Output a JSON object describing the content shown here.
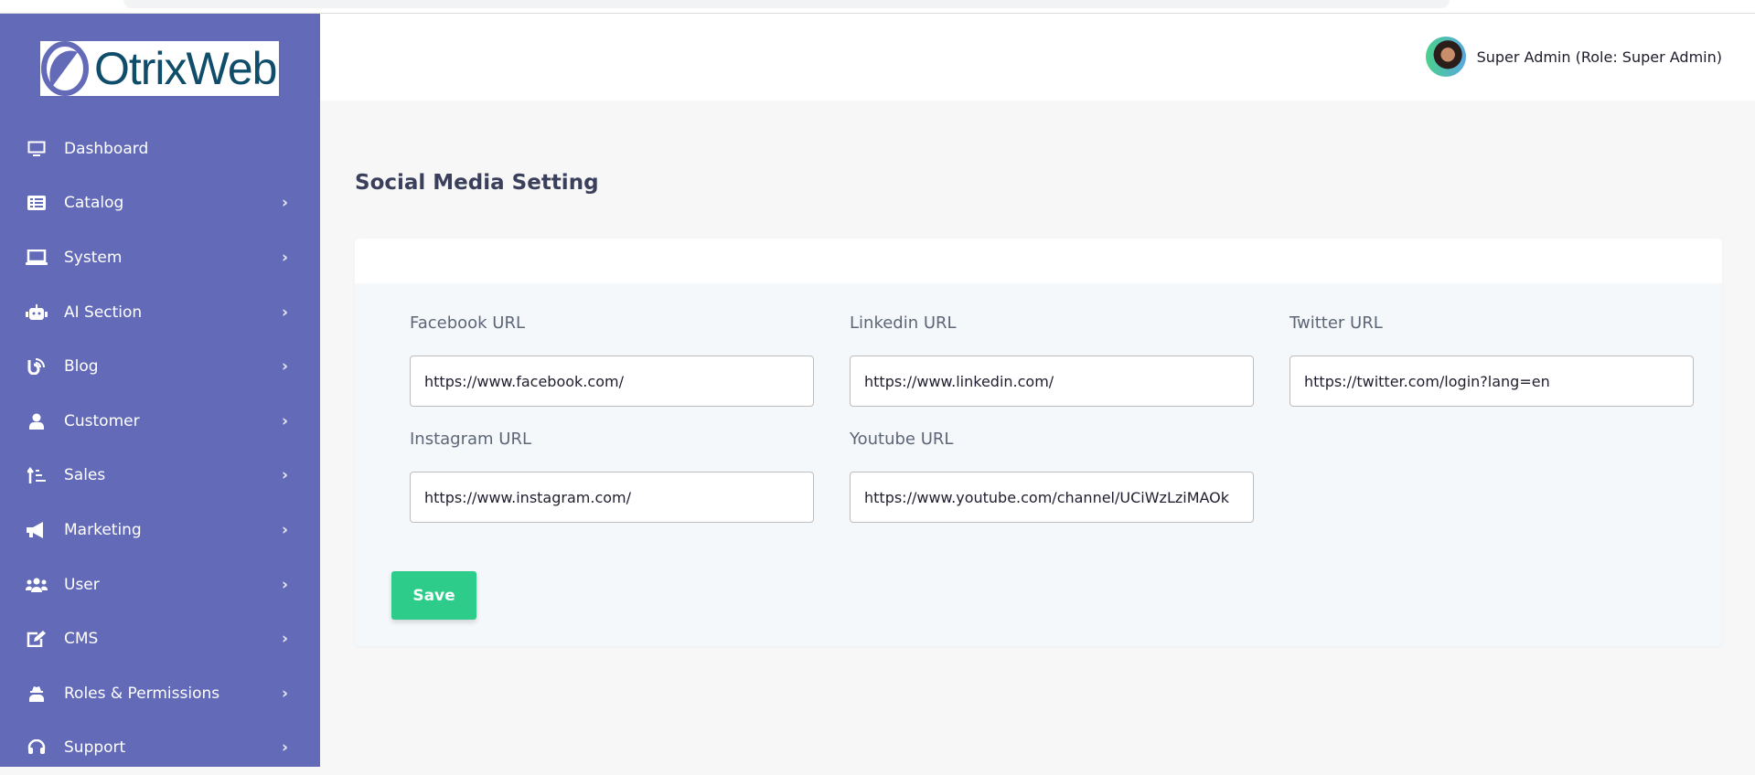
{
  "brand": {
    "logo_text": "OtrixWeb"
  },
  "sidebar": {
    "items": [
      {
        "label": "Dashboard",
        "icon": "monitor-icon",
        "has_children": false
      },
      {
        "label": "Catalog",
        "icon": "list-icon",
        "has_children": true
      },
      {
        "label": "System",
        "icon": "laptop-icon",
        "has_children": true
      },
      {
        "label": "AI Section",
        "icon": "robot-icon",
        "has_children": true
      },
      {
        "label": "Blog",
        "icon": "blog-icon",
        "has_children": true
      },
      {
        "label": "Customer",
        "icon": "user-tie-icon",
        "has_children": true
      },
      {
        "label": "Sales",
        "icon": "sort-amount-icon",
        "has_children": true
      },
      {
        "label": "Marketing",
        "icon": "megaphone-icon",
        "has_children": true
      },
      {
        "label": "User",
        "icon": "users-icon",
        "has_children": true
      },
      {
        "label": "CMS",
        "icon": "edit-icon",
        "has_children": true
      },
      {
        "label": "Roles & Permissions",
        "icon": "user-secret-icon",
        "has_children": true
      },
      {
        "label": "Support",
        "icon": "headset-icon",
        "has_children": true
      }
    ]
  },
  "header": {
    "user_label": "Super Admin (Role: Super Admin)"
  },
  "page": {
    "title": "Social Media Setting"
  },
  "form": {
    "fields": [
      {
        "label": "Facebook URL",
        "value": "https://www.facebook.com/"
      },
      {
        "label": "Linkedin URL",
        "value": "https://www.linkedin.com/"
      },
      {
        "label": "Twitter URL",
        "value": "https://twitter.com/login?lang=en"
      },
      {
        "label": "Instagram URL",
        "value": "https://www.instagram.com/"
      },
      {
        "label": "Youtube URL",
        "value": "https://www.youtube.com/channel/UCiWzLziMAOk"
      }
    ],
    "save_label": "Save"
  },
  "colors": {
    "sidebar": "#636bb9",
    "save": "#2ecc8a",
    "title": "#3a3f5c"
  }
}
